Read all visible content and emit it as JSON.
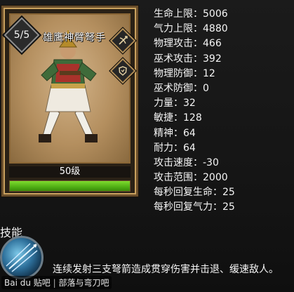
{
  "unit": {
    "stars": "5/5",
    "name": "雄鹰神臂弩手",
    "level": "50级",
    "hp_fraction": 1.0,
    "icons": [
      "crossbow-icon",
      "shield-icon"
    ]
  },
  "stats": [
    "生命上限：5006",
    "气力上限：4880",
    "物理攻击：466",
    "巫术攻击：392",
    "物理防御：12",
    "巫术防御：0",
    "力量：32",
    "敏捷：128",
    "精神：64",
    "耐力：64",
    "攻击速度：-30",
    "攻击范围：2000",
    "每秒回复生命：25",
    "每秒回复气力：25"
  ],
  "skills": {
    "title": "技能",
    "description": "连续发射三支弩箭造成贯穿伤害并击退、缓速敌人。",
    "icon": "crossbow-volley-icon"
  },
  "watermark": {
    "brand": "Bai du 贴吧",
    "forum": "部落与弯刀吧"
  },
  "colors": {
    "frame_gold": "#c9a15e",
    "hp_green": "#4fae14",
    "background": "#141414"
  }
}
